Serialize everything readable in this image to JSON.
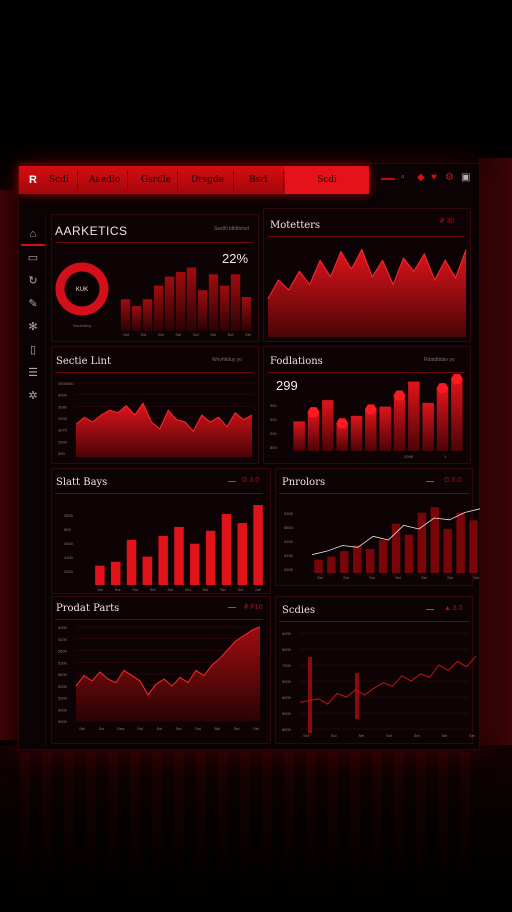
{
  "topbar": {
    "logo": "R",
    "tabs": [
      "Scdi",
      "Aaedlo",
      "Gsrdle",
      "Drsgde",
      "Bsrl",
      "Scdi"
    ],
    "active_tab_index": 5
  },
  "sidebar": {
    "icons": [
      "home-icon",
      "layers-icon",
      "refresh-icon",
      "pen-icon",
      "settings-icon",
      "document-icon",
      "list-icon",
      "gear-icon"
    ]
  },
  "panels": {
    "analytics": {
      "title": "AARKETICS",
      "subtitle": "Swdhl tdldtlotvd",
      "percent": "22%",
      "donut_label": "KUK"
    },
    "markets": {
      "title": "Motetters",
      "control": "₽ 30"
    },
    "sorte_line": {
      "title": "Sectie Lint",
      "subtitle": "Wevhtiduy yo"
    },
    "positions": {
      "title": "Fodlations",
      "subtitle": "Rdatdtidav yo",
      "value": "299"
    },
    "slatt_bays": {
      "title": "Slatt Bays",
      "control": "G 3.0"
    },
    "pardlors": {
      "title": "Pnrolors",
      "control": "G 3.0"
    },
    "prodat_parts": {
      "title": "Prodat Parts",
      "control": "₽ F10"
    },
    "series": {
      "title": "Scdies",
      "control": "▲ 3.0"
    }
  },
  "chart_data": [
    {
      "type": "bar",
      "title": "AARKETICS",
      "values": [
        28,
        22,
        28,
        40,
        48,
        52,
        56,
        36,
        50,
        40,
        50,
        30
      ],
      "categories": [
        "Sel",
        "Sol",
        "Gel",
        "Sel",
        "Sol",
        "Sel",
        "Sel",
        "Sel"
      ]
    },
    {
      "type": "area",
      "title": "Motetters",
      "values": [
        35,
        52,
        43,
        60,
        48,
        70,
        55,
        78,
        62,
        80,
        55,
        70,
        48,
        72,
        60,
        76,
        52,
        70,
        54,
        80
      ]
    },
    {
      "type": "area",
      "title": "Sectie Lint",
      "values": [
        28,
        34,
        30,
        36,
        40,
        38,
        44,
        36,
        46,
        30,
        24,
        40,
        32,
        30,
        22,
        36,
        30,
        34,
        26,
        38,
        32,
        36
      ],
      "yticks": [
        "3000000",
        "3000",
        "3080",
        "2003",
        "3070",
        "2000",
        "300"
      ]
    },
    {
      "type": "bar",
      "title": "Fodlations",
      "values": [
        32,
        42,
        55,
        30,
        38,
        45,
        48,
        60,
        75,
        52,
        68,
        78
      ],
      "ylabels": [
        "350",
        "300",
        "200",
        "800"
      ],
      "xlabels": [
        "2048",
        "1"
      ]
    },
    {
      "type": "bar",
      "title": "Slatt Bays",
      "values": [
        15,
        18,
        35,
        22,
        38,
        45,
        32,
        42,
        55,
        48,
        62
      ],
      "categories": [
        "Sel",
        "Sol",
        "Sol",
        "Sel",
        "Sol",
        "Sel",
        "Sel",
        "Sel",
        "Sel",
        "Sel"
      ],
      "yticks": [
        "3500",
        "800",
        "2500",
        "4100",
        "3000"
      ]
    },
    {
      "type": "bar",
      "title": "Pnrolors",
      "values": [
        12,
        15,
        20,
        25,
        22,
        30,
        45,
        35,
        55,
        60,
        40,
        55,
        48
      ],
      "line": [
        20,
        24,
        30,
        28,
        40,
        36,
        52,
        48,
        60,
        58,
        66,
        70
      ],
      "categories": [
        "Sel",
        "Sol",
        "Sol",
        "Sel",
        "Sel",
        "Sel",
        "Sel"
      ],
      "yticks": [
        "5300",
        "5800",
        "5200",
        "5100",
        "5200"
      ]
    },
    {
      "type": "area",
      "title": "Prodat Parts",
      "values": [
        40,
        52,
        46,
        56,
        48,
        44,
        58,
        52,
        46,
        30,
        42,
        48,
        40,
        50,
        44,
        58,
        52,
        64,
        72,
        82,
        92,
        98,
        104,
        108
      ],
      "categories": [
        "Sel",
        "Sol",
        "Dea",
        "Sel",
        "Sol",
        "Sel",
        "Sel",
        "Bol",
        "Sel",
        "Sel"
      ],
      "yticks": [
        "5000",
        "5200",
        "5600",
        "5300",
        "6600",
        "5000",
        "5300",
        "3000",
        "5900"
      ]
    },
    {
      "type": "line",
      "title": "Scdies",
      "values": [
        30,
        32,
        34,
        28,
        40,
        36,
        44,
        38,
        46,
        52,
        48,
        60,
        54,
        62,
        58,
        72,
        66,
        76,
        70,
        82
      ],
      "categories": [
        "Sel",
        "Sol",
        "Sel",
        "Sel",
        "Sel",
        "Sel",
        "Sel"
      ],
      "yticks": [
        "4000",
        "5000",
        "7000",
        "3000",
        "6000",
        "9000",
        "8000"
      ]
    }
  ],
  "colors": {
    "accent": "#d60f16",
    "dark": "#7a0508",
    "bg": "#0b0203"
  }
}
